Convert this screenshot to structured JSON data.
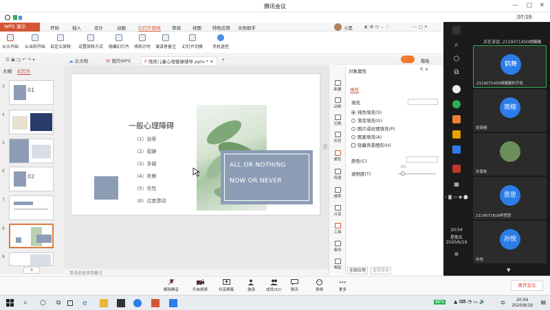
{
  "meeting": {
    "title": "腾讯会议",
    "timer": "07:19"
  },
  "wps": {
    "app_label": "WPS 演示",
    "tabs": [
      "开始",
      "插入",
      "设计",
      "动画",
      "幻灯片放映",
      "审阅",
      "视图",
      "特色应用",
      "文档助手"
    ],
    "active_tab": "幻灯片放映",
    "toolbar": [
      "从头开始",
      "从当前开始",
      "自定义放映",
      "设置放映方式",
      "隐藏幻灯片",
      "排练计时",
      "演讲者备注",
      "幻灯片切换",
      "手机遥控"
    ],
    "user_label": "小黑",
    "doc_tabs": [
      "云文档",
      "我的WPS",
      "残疾儿童心理健康辅导.pptx *"
    ],
    "active_doc": "残疾儿童心理健康辅导.pptx *"
  },
  "thumbnails": {
    "tab_outline": "大纲",
    "tab_slides": "幻灯片",
    "numbers": [
      "3",
      "4",
      "5",
      "6",
      "7",
      "8",
      "9"
    ],
    "selected": "8",
    "labels": {
      "3": "01",
      "6": "02"
    }
  },
  "slide": {
    "heading": "一般心理障碍",
    "items": [
      "（1）自卑",
      "（2）孤僻",
      "（3）多疑",
      "（4）依赖",
      "（5）任性",
      "（6）过度激动"
    ],
    "box_line1": "ALL OR NOTHING",
    "box_line2": "NOW OR NEVER",
    "colors": {
      "box": "#8c9db5"
    }
  },
  "notes_placeholder": "单击此处添加备注",
  "right_tools": [
    "新建",
    "动画",
    "切换",
    "形状",
    "属性",
    "传图",
    "推荐",
    "分享",
    "工具",
    "备份",
    "帮助"
  ],
  "property_panel": {
    "title": "对象属性",
    "tab": "填充",
    "section": "填充",
    "options": [
      "纯色填充(S)",
      "渐变填充(G)",
      "图片或纹理填充(P)",
      "图案填充(A)"
    ],
    "selected_option": "纯色填充(S)",
    "hide_bg": "隐藏背景图形(H)",
    "color_label": "颜色(C)",
    "transparency_label": "透明度(T)",
    "transparency_value": "0%",
    "apply_all": "全部应用",
    "reset_bg": "重置背景"
  },
  "side_clock": {
    "time": "20:04",
    "weekday": "星期五",
    "date": "2020/6/19"
  },
  "participants": {
    "speaking": "正在讲话: 2119071450胡巍巍",
    "people": [
      {
        "avatar": "鹤舞",
        "name": "2119071450胡巍巍的手机"
      },
      {
        "avatar": "简榕",
        "name": "张简榕"
      },
      {
        "avatar": "",
        "name": "孙黄彬"
      },
      {
        "avatar": "思思",
        "name": "2119071618柯思思"
      },
      {
        "avatar": "孙悦",
        "name": "孙悦"
      }
    ]
  },
  "meeting_toolbar": [
    "解除静音",
    "开启视频",
    "共享屏幕",
    "邀请",
    "成员(52)",
    "聊天",
    "表情",
    "更多"
  ],
  "leave_label": "离开会议",
  "taskbar_clock": {
    "time": "20:04",
    "date": "2020/6/19"
  },
  "taskbar_battery": "86%",
  "taskbar_ime": "中"
}
